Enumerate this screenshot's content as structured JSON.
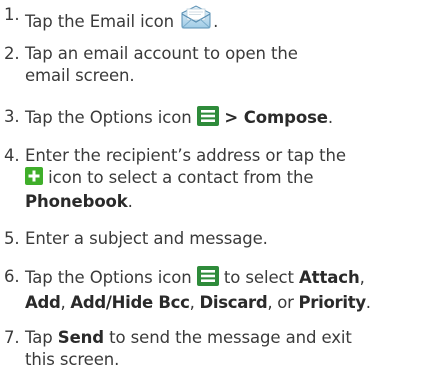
{
  "steps": [
    {
      "num": "1.",
      "a": "Tap the Email icon",
      "b": "."
    },
    {
      "num": "2.",
      "text": "Tap an email account to open the email screen."
    },
    {
      "num": "3.",
      "a": "Tap the Options icon",
      "b": " > ",
      "c": "Compose",
      "d": "."
    },
    {
      "num": "4.",
      "a": "Enter the recipient’s address or tap the",
      "b": " icon to select a contact from the",
      "c": "Phonebook",
      "d": "."
    },
    {
      "num": "5.",
      "text": "Enter a subject and message."
    },
    {
      "num": "6.",
      "a": "Tap the Options icon",
      "b": " to select ",
      "c": "Attach",
      "d": ",",
      "e": "Add",
      "f": ", ",
      "g": "Add/Hide Bcc",
      "h": ", ",
      "i": "Discard",
      "j": ", or ",
      "k": "Priority",
      "l": "."
    },
    {
      "num": "7.",
      "a": "Tap ",
      "b": "Send",
      "c": " to send the message and exit this screen."
    }
  ],
  "icons": {
    "email": "email-envelope-icon",
    "options": "options-menu-icon",
    "add_contact": "add-contact-plus-icon"
  },
  "colors": {
    "text": "#3a3a3a",
    "options_icon_bg": "#2e8b3a",
    "add_icon_bg": "#3fae2a",
    "envelope": "#5aa8d6"
  }
}
